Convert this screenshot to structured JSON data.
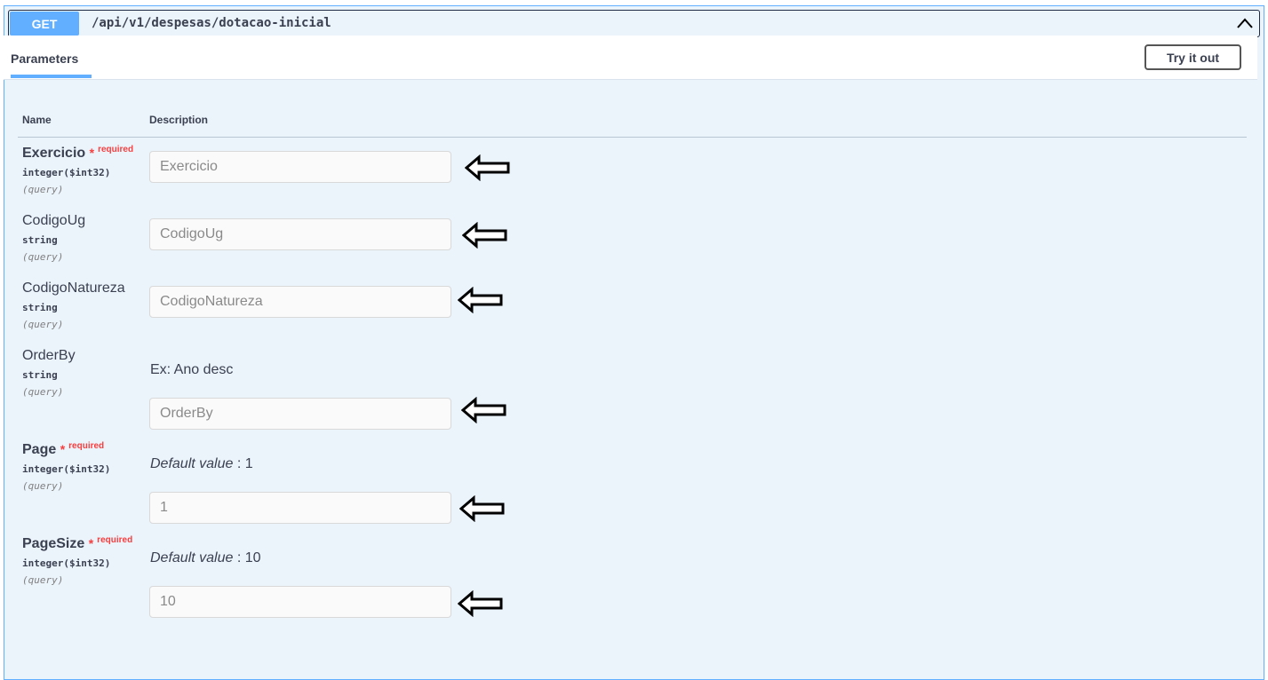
{
  "operation": {
    "method": "GET",
    "path": "/api/v1/despesas/dotacao-inicial"
  },
  "section": {
    "tab_label": "Parameters",
    "try_button_label": "Try it out"
  },
  "table": {
    "col_name": "Name",
    "col_description": "Description"
  },
  "params": [
    {
      "name": "Exercicio",
      "star": "*",
      "required": "required",
      "type": "integer($int32)",
      "in": "(query)",
      "placeholder": "Exercicio",
      "value": ""
    },
    {
      "name": "CodigoUg",
      "type": "string",
      "in": "(query)",
      "placeholder": "CodigoUg",
      "value": ""
    },
    {
      "name": "CodigoNatureza",
      "type": "string",
      "in": "(query)",
      "placeholder": "CodigoNatureza",
      "value": ""
    },
    {
      "name": "OrderBy",
      "type": "string",
      "in": "(query)",
      "description": "Ex: Ano desc",
      "placeholder": "OrderBy",
      "value": ""
    },
    {
      "name": "Page",
      "star": "*",
      "required": "required",
      "type": "integer($int32)",
      "in": "(query)",
      "default_label": "Default value",
      "default_sep": " : 1",
      "placeholder": "1",
      "value": ""
    },
    {
      "name": "PageSize",
      "star": "*",
      "required": "required",
      "type": "integer($int32)",
      "in": "(query)",
      "default_label": "Default value",
      "default_sep": " : 10",
      "placeholder": "10",
      "value": ""
    }
  ],
  "icons": {
    "collapse": "chevron-up-icon",
    "pointer": "arrow-left-outline-icon"
  },
  "colors": {
    "get_method": "#61affe",
    "block_bg": "#ebf3fb",
    "required": "#f93e3e"
  }
}
